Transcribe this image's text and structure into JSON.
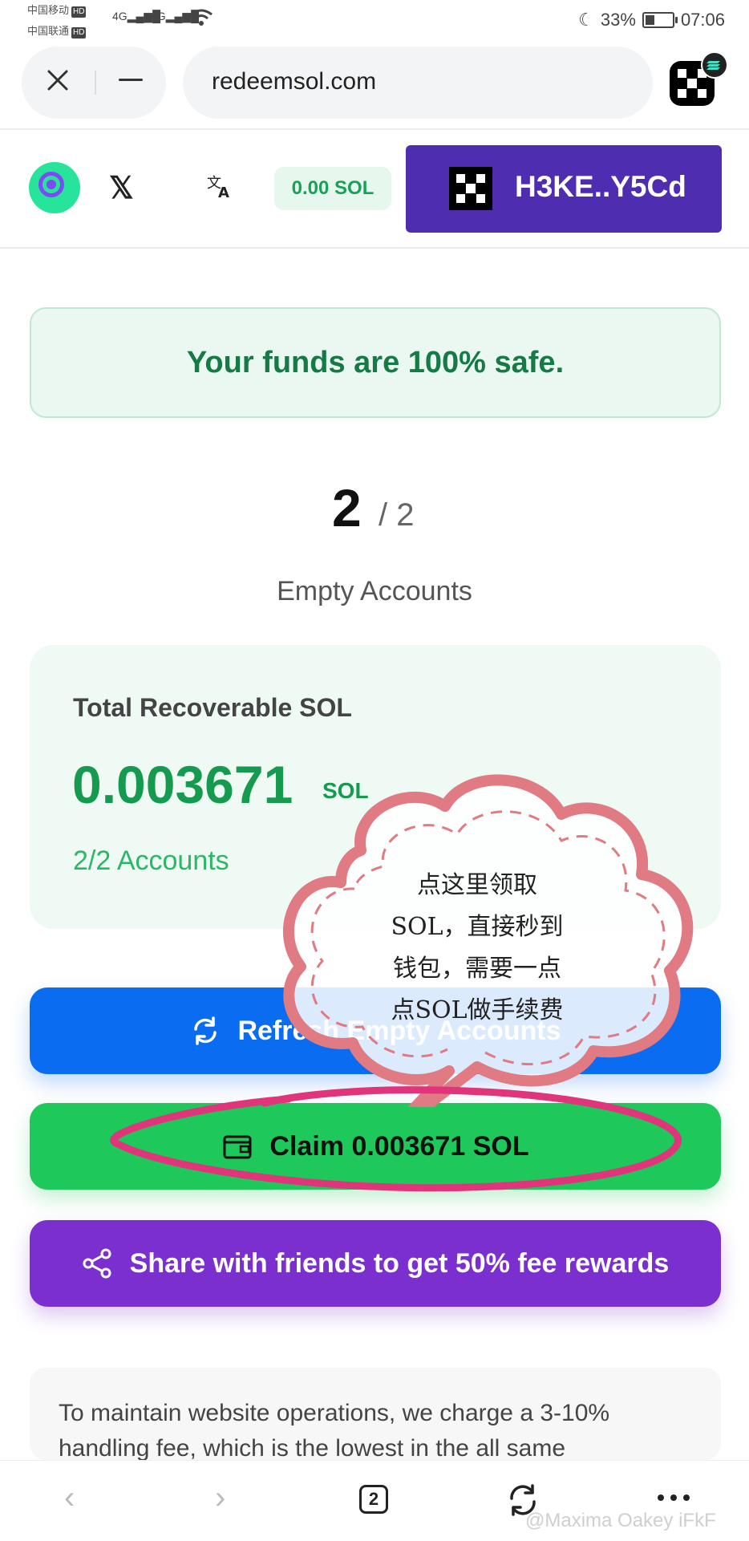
{
  "status_bar": {
    "carrier1": "中国移动",
    "carrier2": "中国联通",
    "hd": "HD",
    "signal1": "4G",
    "signal2": "4G",
    "battery": "33%",
    "time": "07:06"
  },
  "browser": {
    "url": "redeemsol.com",
    "tabs_count": "2"
  },
  "header": {
    "balance": "0.00 SOL",
    "wallet_address": "H3KE..Y5Cd"
  },
  "banner": {
    "text": "Your funds are 100% safe."
  },
  "counter": {
    "current": "2",
    "total": "/ 2",
    "label": "Empty Accounts"
  },
  "card": {
    "title": "Total Recoverable SOL",
    "amount": "0.003671",
    "unit": "SOL",
    "accounts": "2/2 Accounts"
  },
  "buttons": {
    "refresh": "Refresh Empty Accounts",
    "claim": "Claim 0.003671 SOL",
    "share": "Share with friends to get 50% fee rewards"
  },
  "info": {
    "text": "To maintain website operations, we charge a 3-10% handling fee, which is the lowest in the all same"
  },
  "annotation": {
    "line1": "点这里领取",
    "line2": "SOL，直接秒到",
    "line3": "钱包，需要一点",
    "line4": "点SOL做手续费"
  },
  "watermark": "@Maxima Oakey iFkF",
  "colors": {
    "accent_green": "#1ec85b",
    "refresh_blue": "#0a6cf0",
    "share_purple": "#7b2fcf",
    "wallet_purple": "#4f2db0"
  }
}
